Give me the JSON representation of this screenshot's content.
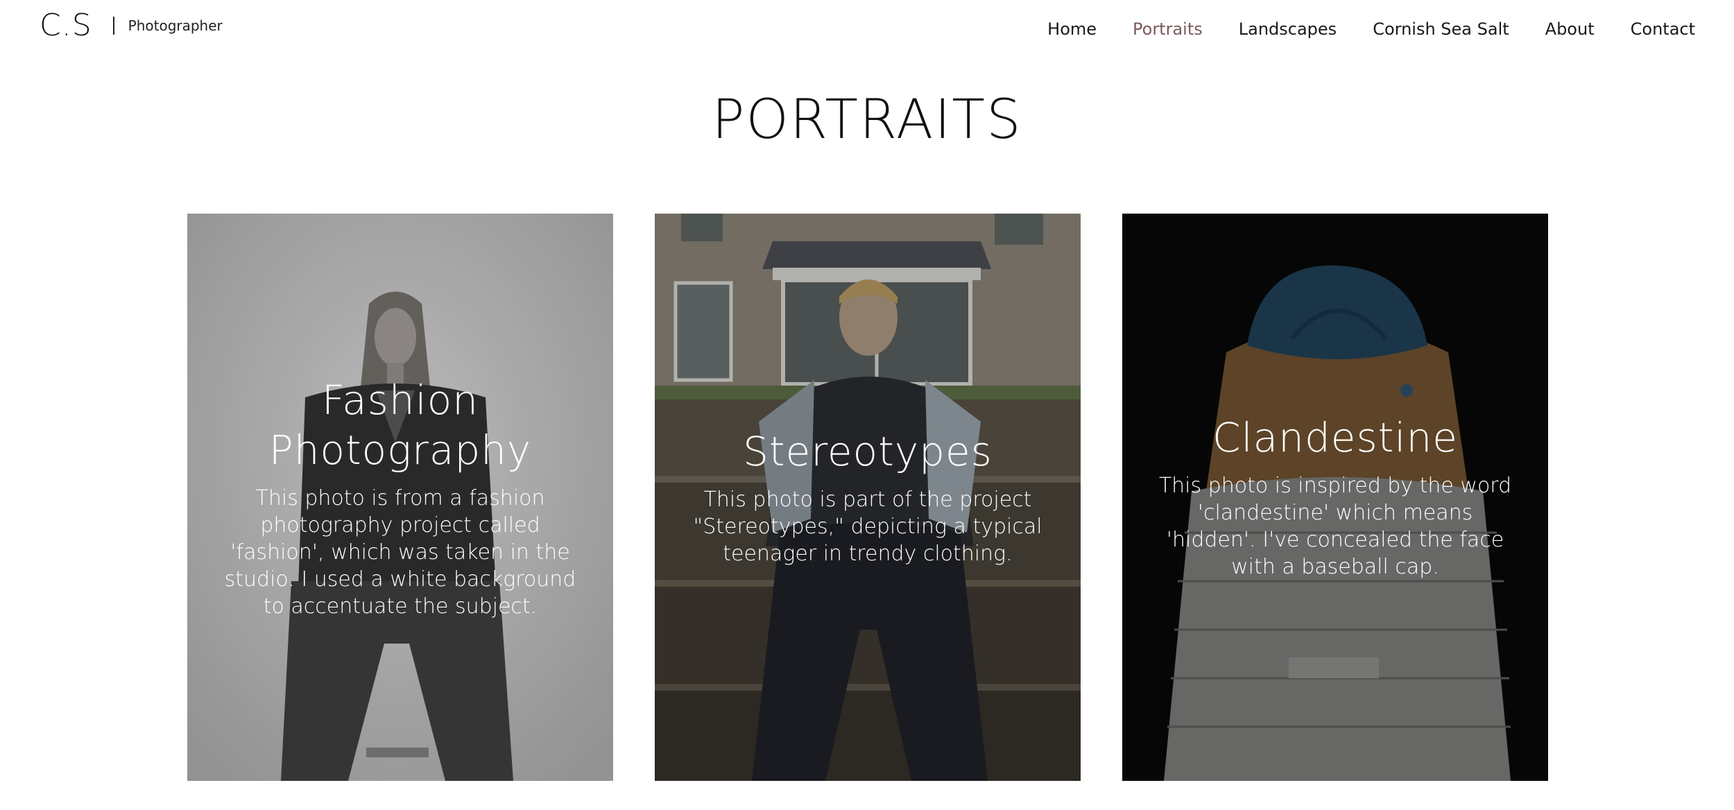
{
  "header": {
    "logo": "C.S",
    "tagline": "Photographer",
    "nav": [
      {
        "label": "Home",
        "active": false
      },
      {
        "label": "Portraits",
        "active": true
      },
      {
        "label": "Landscapes",
        "active": false
      },
      {
        "label": "Cornish Sea Salt",
        "active": false
      },
      {
        "label": "About",
        "active": false
      },
      {
        "label": "Contact",
        "active": false
      }
    ],
    "active_color": "#7d5a5a"
  },
  "page": {
    "title": "PORTRAITS"
  },
  "cards": [
    {
      "title": "Fashion Photography",
      "description": "This photo is from a fashion photography project called 'fashion', which was taken in the studio. I used a white background to accentuate the subject."
    },
    {
      "title": "Stereotypes",
      "description": "This photo is part of the project \"Stereotypes,\" depicting a typical teenager in trendy clothing."
    },
    {
      "title": "Clandestine",
      "description": "This photo is inspired by the word 'clandestine' which means 'hidden'. I've concealed the face with a baseball cap."
    }
  ]
}
